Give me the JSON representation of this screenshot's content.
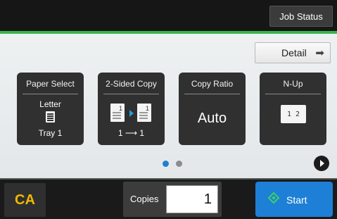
{
  "header": {
    "job_status_label": "Job Status"
  },
  "detail": {
    "label": "Detail",
    "icon": "arrow-right-icon"
  },
  "tiles": {
    "paper_select": {
      "title": "Paper Select",
      "paper": "Letter",
      "tray": "Tray 1",
      "icon": "paper-sheet-icon"
    },
    "two_sided": {
      "title": "2-Sided Copy",
      "page_front": "1",
      "page_back": "1",
      "caption": "1 ⟶ 1",
      "icon": "duplex-pages-icon"
    },
    "copy_ratio": {
      "title": "Copy Ratio",
      "value": "Auto"
    },
    "n_up": {
      "title": "N-Up",
      "cell_1": "1",
      "cell_2": "2",
      "icon": "two-up-layout-icon"
    }
  },
  "pager": {
    "current_page": 1,
    "total_pages": 2
  },
  "bottom_bar": {
    "clear_all_label": "CA",
    "copies_label": "Copies",
    "copies_value": "1",
    "start_label": "Start",
    "start_icon": "start-diamond-icon"
  },
  "colors": {
    "accent_green": "#3ab54a",
    "start_blue": "#1e7fd6",
    "ca_yellow": "#f0b800",
    "pager_active": "#1f7fcf"
  }
}
